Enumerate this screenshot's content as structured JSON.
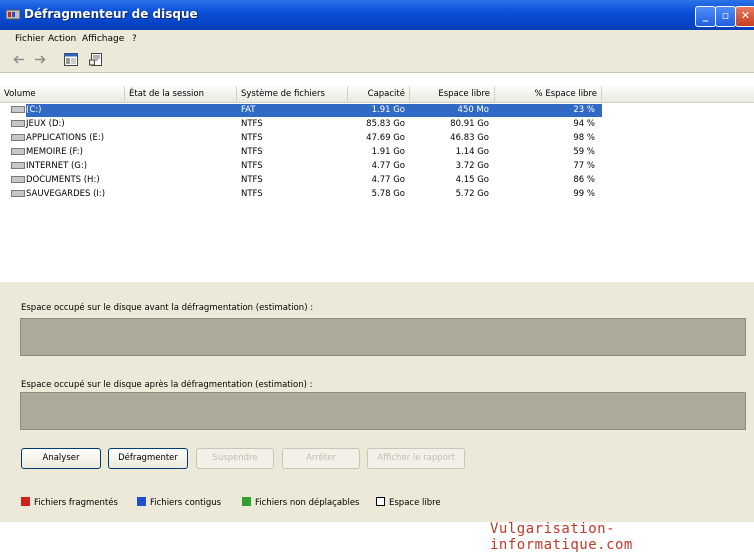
{
  "window": {
    "title": "Défragmenteur de disque"
  },
  "menu": {
    "fichier": "Fichier",
    "action": "Action",
    "affichage": "Affichage",
    "aide": "?"
  },
  "toolbar": {
    "icons": [
      "back-arrow-icon",
      "forward-arrow-icon",
      "console-icon",
      "properties-icon"
    ]
  },
  "table": {
    "headers": [
      "Volume",
      "État de la session",
      "Système de fichiers",
      "Capacité",
      "Espace libre",
      "% Espace libre"
    ],
    "rows": [
      {
        "volume": "(C:)",
        "session": "",
        "fs": "FAT",
        "capacity": "1.91 Go",
        "free": "450 Mo",
        "pct": "23 %"
      },
      {
        "volume": "JEUX (D:)",
        "session": "",
        "fs": "NTFS",
        "capacity": "85.83 Go",
        "free": "80.91 Go",
        "pct": "94 %"
      },
      {
        "volume": "APPLICATIONS (E:)",
        "session": "",
        "fs": "NTFS",
        "capacity": "47.69 Go",
        "free": "46.83 Go",
        "pct": "98 %"
      },
      {
        "volume": "MEMOIRE (F:)",
        "session": "",
        "fs": "NTFS",
        "capacity": "1.91 Go",
        "free": "1.14 Go",
        "pct": "59 %"
      },
      {
        "volume": "INTERNET (G:)",
        "session": "",
        "fs": "NTFS",
        "capacity": "4.77 Go",
        "free": "3.72 Go",
        "pct": "77 %"
      },
      {
        "volume": "DOCUMENTS (H:)",
        "session": "",
        "fs": "NTFS",
        "capacity": "4.77 Go",
        "free": "4.15 Go",
        "pct": "86 %"
      },
      {
        "volume": "SAUVEGARDES (I:)",
        "session": "",
        "fs": "NTFS",
        "capacity": "5.78 Go",
        "free": "5.72 Go",
        "pct": "99 %"
      }
    ]
  },
  "estimates": {
    "before": "Espace occupé sur le disque avant la défragmentation (estimation) :",
    "after": "Espace occupé sur le disque après la défragmentation (estimation) :"
  },
  "buttons": {
    "analyser": "Analyser",
    "defragmenter": "Défragmenter",
    "suspendre": "Suspendre",
    "arreter": "Arrêter",
    "rapport": "Afficher le rapport"
  },
  "legend": [
    {
      "label": "Fichiers fragmentés",
      "color": "#d02020"
    },
    {
      "label": "Fichiers contigus",
      "color": "#2050d0"
    },
    {
      "label": "Fichiers non déplaçables",
      "color": "#30a030"
    },
    {
      "label": "Espace libre",
      "color": "#ffffff"
    }
  ],
  "watermark": "Vulgarisation-informatique.com"
}
